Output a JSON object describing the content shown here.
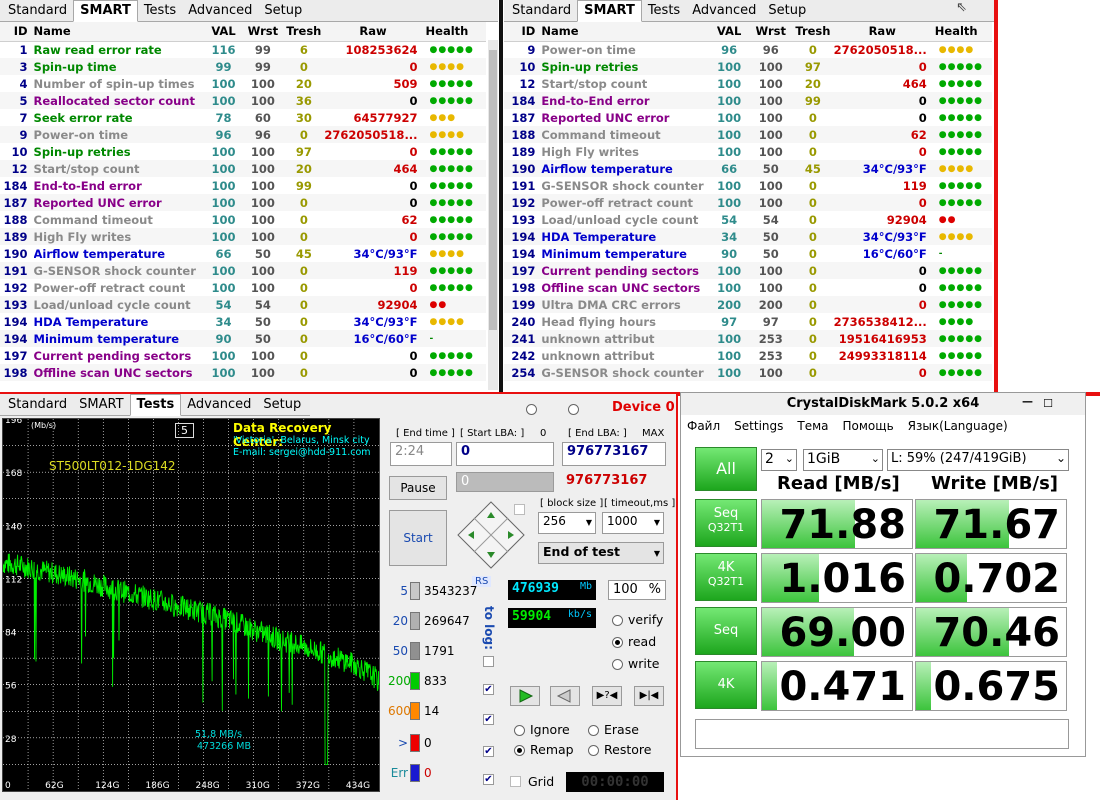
{
  "smart_left": {
    "tabs": [
      "Standard",
      "SMART",
      "Tests",
      "Advanced",
      "Setup"
    ],
    "active_tab": "SMART",
    "columns": [
      "ID",
      "Name",
      "VAL",
      "Wrst",
      "Tresh",
      "Raw",
      "Health"
    ],
    "rows": [
      {
        "id": "1",
        "name": "Raw read error rate",
        "val": "116",
        "wrst": "99",
        "tresh": "6",
        "raw": "108253624",
        "health": "●●●●●",
        "nc": "st-green",
        "rc": "raw-red",
        "hc": "h-g"
      },
      {
        "id": "3",
        "name": "Spin-up time",
        "val": "99",
        "wrst": "99",
        "tresh": "0",
        "raw": "0",
        "health": "●●●●",
        "nc": "st-green",
        "rc": "raw-red",
        "hc": "h-y"
      },
      {
        "id": "4",
        "name": "Number of spin-up times",
        "val": "100",
        "wrst": "100",
        "tresh": "20",
        "raw": "509",
        "health": "●●●●●",
        "nc": "st-gray",
        "rc": "raw-red",
        "hc": "h-g"
      },
      {
        "id": "5",
        "name": "Reallocated sector count",
        "val": "100",
        "wrst": "100",
        "tresh": "36",
        "raw": "0",
        "health": "●●●●●",
        "nc": "st-purple",
        "rc": "raw-black",
        "hc": "h-g"
      },
      {
        "id": "7",
        "name": "Seek error rate",
        "val": "78",
        "wrst": "60",
        "tresh": "30",
        "raw": "64577927",
        "health": "●●●",
        "nc": "st-green",
        "rc": "raw-red",
        "hc": "h-y"
      },
      {
        "id": "9",
        "name": "Power-on time",
        "val": "96",
        "wrst": "96",
        "tresh": "0",
        "raw": "2762050518...",
        "health": "●●●●",
        "nc": "st-gray",
        "rc": "raw-red",
        "hc": "h-y"
      },
      {
        "id": "10",
        "name": "Spin-up retries",
        "val": "100",
        "wrst": "100",
        "tresh": "97",
        "raw": "0",
        "health": "●●●●●",
        "nc": "st-green",
        "rc": "raw-red",
        "hc": "h-g"
      },
      {
        "id": "12",
        "name": "Start/stop count",
        "val": "100",
        "wrst": "100",
        "tresh": "20",
        "raw": "464",
        "health": "●●●●●",
        "nc": "st-gray",
        "rc": "raw-red",
        "hc": "h-g"
      },
      {
        "id": "184",
        "name": "End-to-End error",
        "val": "100",
        "wrst": "100",
        "tresh": "99",
        "raw": "0",
        "health": "●●●●●",
        "nc": "st-purple",
        "rc": "raw-black",
        "hc": "h-g"
      },
      {
        "id": "187",
        "name": "Reported UNC error",
        "val": "100",
        "wrst": "100",
        "tresh": "0",
        "raw": "0",
        "health": "●●●●●",
        "nc": "st-purple",
        "rc": "raw-black",
        "hc": "h-g"
      },
      {
        "id": "188",
        "name": "Command timeout",
        "val": "100",
        "wrst": "100",
        "tresh": "0",
        "raw": "62",
        "health": "●●●●●",
        "nc": "st-gray",
        "rc": "raw-red",
        "hc": "h-g"
      },
      {
        "id": "189",
        "name": "High Fly writes",
        "val": "100",
        "wrst": "100",
        "tresh": "0",
        "raw": "0",
        "health": "●●●●●",
        "nc": "st-gray",
        "rc": "raw-red",
        "hc": "h-g"
      },
      {
        "id": "190",
        "name": "Airflow temperature",
        "val": "66",
        "wrst": "50",
        "tresh": "45",
        "raw": "34°C/93°F",
        "health": "●●●●",
        "nc": "st-blue",
        "rc": "raw-blue",
        "hc": "h-y"
      },
      {
        "id": "191",
        "name": "G-SENSOR shock counter",
        "val": "100",
        "wrst": "100",
        "tresh": "0",
        "raw": "119",
        "health": "●●●●●",
        "nc": "st-gray",
        "rc": "raw-red",
        "hc": "h-g"
      },
      {
        "id": "192",
        "name": "Power-off retract count",
        "val": "100",
        "wrst": "100",
        "tresh": "0",
        "raw": "0",
        "health": "●●●●●",
        "nc": "st-gray",
        "rc": "raw-red",
        "hc": "h-g"
      },
      {
        "id": "193",
        "name": "Load/unload cycle count",
        "val": "54",
        "wrst": "54",
        "tresh": "0",
        "raw": "92904",
        "health": "●●",
        "nc": "st-gray",
        "rc": "raw-red",
        "hc": "h-r"
      },
      {
        "id": "194",
        "name": "HDA Temperature",
        "val": "34",
        "wrst": "50",
        "tresh": "0",
        "raw": "34°C/93°F",
        "health": "●●●●",
        "nc": "st-blue",
        "rc": "raw-blue",
        "hc": "h-y"
      },
      {
        "id": "194",
        "name": "Minimum temperature",
        "val": "90",
        "wrst": "50",
        "tresh": "0",
        "raw": "16°C/60°F",
        "health": "-",
        "nc": "st-blue",
        "rc": "raw-blue",
        "hc": "h-dash"
      },
      {
        "id": "197",
        "name": "Current pending sectors",
        "val": "100",
        "wrst": "100",
        "tresh": "0",
        "raw": "0",
        "health": "●●●●●",
        "nc": "st-purple",
        "rc": "raw-black",
        "hc": "h-g"
      },
      {
        "id": "198",
        "name": "Offline scan UNC sectors",
        "val": "100",
        "wrst": "100",
        "tresh": "0",
        "raw": "0",
        "health": "●●●●●",
        "nc": "st-purple",
        "rc": "raw-black",
        "hc": "h-g"
      }
    ]
  },
  "smart_right": {
    "tabs": [
      "Standard",
      "SMART",
      "Tests",
      "Advanced",
      "Setup"
    ],
    "active_tab": "SMART",
    "columns": [
      "ID",
      "Name",
      "VAL",
      "Wrst",
      "Tresh",
      "Raw",
      "Health"
    ],
    "rows": [
      {
        "id": "9",
        "name": "Power-on time",
        "val": "96",
        "wrst": "96",
        "tresh": "0",
        "raw": "2762050518...",
        "health": "●●●●",
        "nc": "st-gray",
        "rc": "raw-red",
        "hc": "h-y"
      },
      {
        "id": "10",
        "name": "Spin-up retries",
        "val": "100",
        "wrst": "100",
        "tresh": "97",
        "raw": "0",
        "health": "●●●●●",
        "nc": "st-green",
        "rc": "raw-red",
        "hc": "h-g"
      },
      {
        "id": "12",
        "name": "Start/stop count",
        "val": "100",
        "wrst": "100",
        "tresh": "20",
        "raw": "464",
        "health": "●●●●●",
        "nc": "st-gray",
        "rc": "raw-red",
        "hc": "h-g"
      },
      {
        "id": "184",
        "name": "End-to-End error",
        "val": "100",
        "wrst": "100",
        "tresh": "99",
        "raw": "0",
        "health": "●●●●●",
        "nc": "st-purple",
        "rc": "raw-black",
        "hc": "h-g"
      },
      {
        "id": "187",
        "name": "Reported UNC error",
        "val": "100",
        "wrst": "100",
        "tresh": "0",
        "raw": "0",
        "health": "●●●●●",
        "nc": "st-purple",
        "rc": "raw-black",
        "hc": "h-g"
      },
      {
        "id": "188",
        "name": "Command timeout",
        "val": "100",
        "wrst": "100",
        "tresh": "0",
        "raw": "62",
        "health": "●●●●●",
        "nc": "st-gray",
        "rc": "raw-red",
        "hc": "h-g"
      },
      {
        "id": "189",
        "name": "High Fly writes",
        "val": "100",
        "wrst": "100",
        "tresh": "0",
        "raw": "0",
        "health": "●●●●●",
        "nc": "st-gray",
        "rc": "raw-red",
        "hc": "h-g"
      },
      {
        "id": "190",
        "name": "Airflow temperature",
        "val": "66",
        "wrst": "50",
        "tresh": "45",
        "raw": "34°C/93°F",
        "health": "●●●●",
        "nc": "st-blue",
        "rc": "raw-blue",
        "hc": "h-y"
      },
      {
        "id": "191",
        "name": "G-SENSOR shock counter",
        "val": "100",
        "wrst": "100",
        "tresh": "0",
        "raw": "119",
        "health": "●●●●●",
        "nc": "st-gray",
        "rc": "raw-red",
        "hc": "h-g"
      },
      {
        "id": "192",
        "name": "Power-off retract count",
        "val": "100",
        "wrst": "100",
        "tresh": "0",
        "raw": "0",
        "health": "●●●●●",
        "nc": "st-gray",
        "rc": "raw-red",
        "hc": "h-g"
      },
      {
        "id": "193",
        "name": "Load/unload cycle count",
        "val": "54",
        "wrst": "54",
        "tresh": "0",
        "raw": "92904",
        "health": "●●",
        "nc": "st-gray",
        "rc": "raw-red",
        "hc": "h-r"
      },
      {
        "id": "194",
        "name": "HDA Temperature",
        "val": "34",
        "wrst": "50",
        "tresh": "0",
        "raw": "34°C/93°F",
        "health": "●●●●",
        "nc": "st-blue",
        "rc": "raw-blue",
        "hc": "h-y"
      },
      {
        "id": "194",
        "name": "Minimum temperature",
        "val": "90",
        "wrst": "50",
        "tresh": "0",
        "raw": "16°C/60°F",
        "health": "-",
        "nc": "st-blue",
        "rc": "raw-blue",
        "hc": "h-dash"
      },
      {
        "id": "197",
        "name": "Current pending sectors",
        "val": "100",
        "wrst": "100",
        "tresh": "0",
        "raw": "0",
        "health": "●●●●●",
        "nc": "st-purple",
        "rc": "raw-black",
        "hc": "h-g"
      },
      {
        "id": "198",
        "name": "Offline scan UNC sectors",
        "val": "100",
        "wrst": "100",
        "tresh": "0",
        "raw": "0",
        "health": "●●●●●",
        "nc": "st-purple",
        "rc": "raw-black",
        "hc": "h-g"
      },
      {
        "id": "199",
        "name": "Ultra DMA CRC errors",
        "val": "200",
        "wrst": "200",
        "tresh": "0",
        "raw": "0",
        "health": "●●●●●",
        "nc": "st-gray",
        "rc": "raw-red",
        "hc": "h-g"
      },
      {
        "id": "240",
        "name": "Head flying hours",
        "val": "97",
        "wrst": "97",
        "tresh": "0",
        "raw": "2736538412...",
        "health": "●●●●",
        "nc": "st-gray",
        "rc": "raw-red",
        "hc": "h-g"
      },
      {
        "id": "241",
        "name": "unknown attribut",
        "val": "100",
        "wrst": "253",
        "tresh": "0",
        "raw": "19516416953",
        "health": "●●●●●",
        "nc": "st-gray",
        "rc": "raw-red",
        "hc": "h-g"
      },
      {
        "id": "242",
        "name": "unknown attribut",
        "val": "100",
        "wrst": "253",
        "tresh": "0",
        "raw": "24993318114",
        "health": "●●●●●",
        "nc": "st-gray",
        "rc": "raw-red",
        "hc": "h-g"
      },
      {
        "id": "254",
        "name": "G-SENSOR shock counter",
        "val": "100",
        "wrst": "100",
        "tresh": "0",
        "raw": "0",
        "health": "●●●●●",
        "nc": "st-gray",
        "rc": "raw-red",
        "hc": "h-g"
      }
    ]
  },
  "test": {
    "tabs": [
      "Standard",
      "SMART",
      "Tests",
      "Advanced",
      "Setup"
    ],
    "active_tab": "Tests",
    "device_label": "Device 0",
    "graph": {
      "y_unit": "(Mb/s)",
      "y_ticks": [
        "196",
        "168",
        "140",
        "112",
        "84",
        "56",
        "28"
      ],
      "x_ticks": [
        "0",
        "62G",
        "124G",
        "186G",
        "248G",
        "310G",
        "372G",
        "434G"
      ],
      "block_number": "5",
      "drive_model": "ST500LT012-1DG142",
      "center_title": "Data Recovery Center:",
      "center_city": "'Victoria', Belarus, Minsk city",
      "center_email": "E-mail: sergei@hdd-911.com",
      "speed_readout": "51,8 MB/s",
      "pos_readout": "473266 MB",
      "line_color": "#00ee00"
    },
    "chart_data": {
      "type": "line",
      "ylabel": "(Mb/s)",
      "ylim": [
        0,
        196
      ],
      "xlim": [
        0,
        465
      ],
      "x_ticks": [
        "0",
        "62G",
        "124G",
        "186G",
        "248G",
        "310G",
        "372G",
        "434G"
      ],
      "series": [
        {
          "values": [
            [
              0,
              120
            ],
            [
              20,
              119
            ],
            [
              40,
              117
            ],
            [
              60,
              115
            ],
            [
              80,
              113
            ],
            [
              100,
              111
            ],
            [
              124,
              108
            ],
            [
              150,
              105
            ],
            [
              186,
              101
            ],
            [
              210,
              98
            ],
            [
              248,
              94
            ],
            [
              280,
              90
            ],
            [
              310,
              85
            ],
            [
              340,
              80
            ],
            [
              372,
              76
            ],
            [
              400,
              72
            ],
            [
              434,
              67
            ],
            [
              460,
              60
            ],
            [
              473,
              52
            ]
          ]
        }
      ]
    },
    "end_time_label": "[ End time ]",
    "end_time_value": "2:24",
    "start_lba_label": "[ Start LBA: ]",
    "start_lba_zero": "0",
    "start_lba_value": "0",
    "end_lba_label": "[ End LBA: ]",
    "end_lba_max": "MAX",
    "end_lba_value": "976773167",
    "current_lba": "0",
    "current_lba_end": "976773167",
    "pause_label": "Pause",
    "start_label": "Start",
    "block_size_label": "[ block size ]",
    "block_size_value": "256",
    "timeout_label": "[ timeout,ms ]",
    "timeout_value": "1000",
    "end_action": "End of test",
    "rs_label": "RS",
    "to_log_label": "to log:",
    "legend": [
      {
        "label": "5",
        "color": "#c8c8c8",
        "count": "3543237"
      },
      {
        "label": "20",
        "color": "#b0b0b0",
        "count": "269647"
      },
      {
        "label": "50",
        "color": "#909090",
        "count": "1791"
      },
      {
        "label": "200",
        "color": "#00cc00",
        "count": "833"
      },
      {
        "label": "600",
        "color": "#ff8800",
        "count": "14"
      },
      {
        "label": ">",
        "color": "#ee0000",
        "count": "0"
      },
      {
        "label": "Err",
        "color": "#1a1ad0",
        "count": "0"
      }
    ],
    "mb_value": "476939",
    "mb_unit": "Mb",
    "percent_value": "100",
    "percent_unit": "%",
    "kbs_value": "59904",
    "kbs_unit": "kb/s",
    "verify_label": "verify",
    "read_label": "read",
    "write_label": "write",
    "ignore_label": "Ignore",
    "erase_label": "Erase",
    "remap_label": "Remap",
    "restore_label": "Restore",
    "grid_label": "Grid",
    "timer_value": "00:00:00",
    "mode_selected": "read",
    "action_selected": "Remap"
  },
  "cdm": {
    "title": "CrystalDiskMark 5.0.2 x64",
    "menu": [
      "Файл",
      "Settings",
      "Тема",
      "Помощь",
      "Язык(Language)"
    ],
    "all_label": "All",
    "count_value": "2",
    "size_value": "1GiB",
    "drive_value": "L: 59% (247/419GiB)",
    "read_header": "Read [MB/s]",
    "write_header": "Write [MB/s]",
    "rows": [
      {
        "label1": "Seq",
        "label2": "Q32T1",
        "read": "71.88",
        "write": "71.67",
        "read_fill": 0.62,
        "write_fill": 0.62
      },
      {
        "label1": "4K",
        "label2": "Q32T1",
        "read": "1.016",
        "write": "0.702",
        "read_fill": 0.38,
        "write_fill": 0.34
      },
      {
        "label1": "Seq",
        "label2": "",
        "read": "69.00",
        "write": "70.46",
        "read_fill": 0.61,
        "write_fill": 0.62
      },
      {
        "label1": "4K",
        "label2": "",
        "read": "0.471",
        "write": "0.675",
        "read_fill": 0.1,
        "write_fill": 0.1
      }
    ],
    "accent": "#2ab02a"
  },
  "colors": {
    "divider_red": "#e81010"
  }
}
